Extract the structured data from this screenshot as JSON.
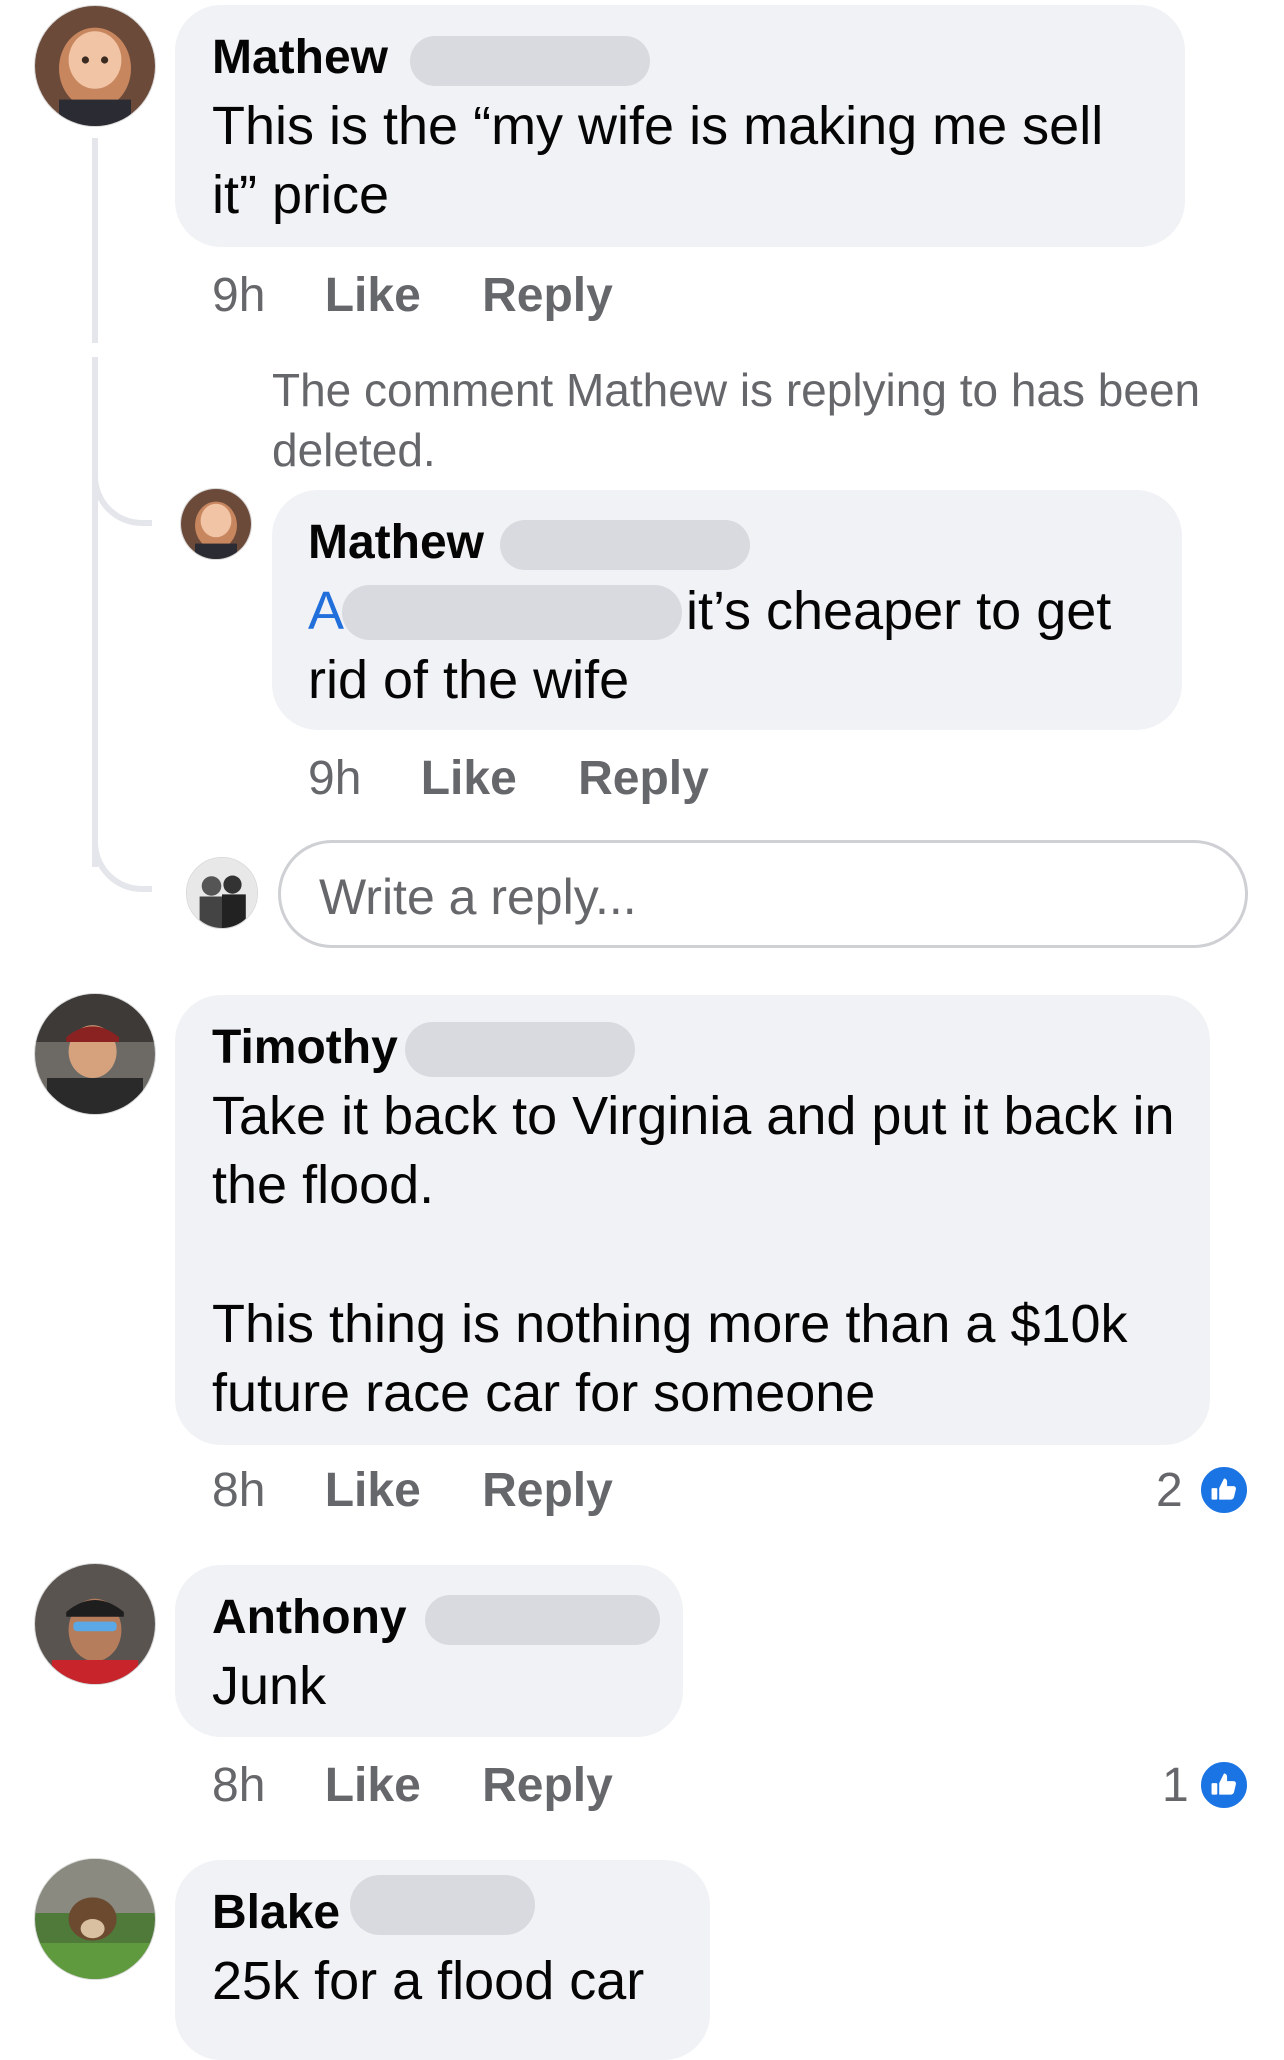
{
  "comments": [
    {
      "name": "Mathew",
      "text": "This is the “my wife is making me sell it” price",
      "time": "9h",
      "like": "Like",
      "reply": "Reply"
    },
    {
      "name": "Timothy",
      "text_p1": "Take it back to Virginia and put it back in the flood.",
      "text_p2": "This thing is nothing more than a $10k future race car for someone",
      "time": "8h",
      "like": "Like",
      "reply": "Reply",
      "reaction_count": "2"
    },
    {
      "name": "Anthony",
      "text": "Junk",
      "time": "8h",
      "like": "Like",
      "reply": "Reply",
      "reaction_count": "1"
    },
    {
      "name": "Blake",
      "text": "25k for a flood car"
    }
  ],
  "deleted_notice": "The comment Mathew is replying to has been deleted.",
  "reply": {
    "name": "Mathew",
    "mention_start": "A",
    "text_line1": "it’s cheaper to get",
    "text_line2": "rid of the wife",
    "time": "9h",
    "like": "Like",
    "reply": "Reply"
  },
  "write_reply": {
    "placeholder": "Write a reply..."
  },
  "colors": {
    "bubble": "#f0f2f5",
    "meta_text": "#65676b",
    "mention": "#216fdb",
    "like_badge": "#1b74e4"
  },
  "icons": {
    "reaction": "thumbs-up-icon"
  }
}
